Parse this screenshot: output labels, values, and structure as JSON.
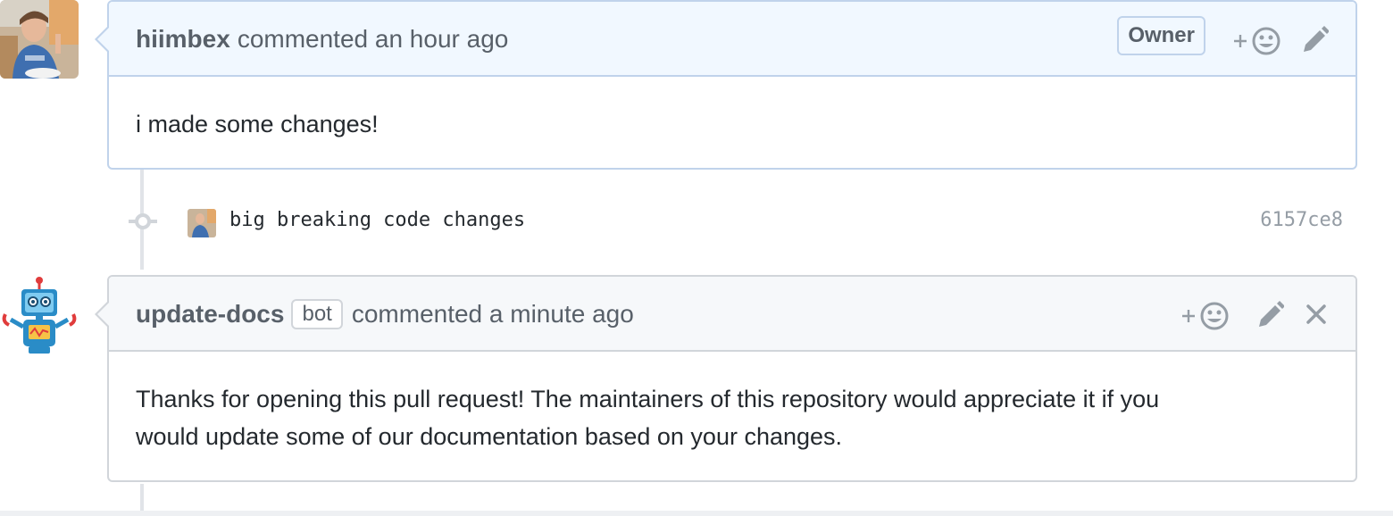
{
  "comment1": {
    "author": "hiimbex",
    "action": "commented an hour ago",
    "label": "Owner",
    "body": "i made some changes!",
    "icons": [
      "add-reaction-icon",
      "edit-pencil-icon"
    ]
  },
  "commit": {
    "message": "big breaking code changes",
    "sha": "6157ce8"
  },
  "comment2": {
    "author": "update-docs",
    "badge": "bot",
    "action": "commented a minute ago",
    "body_line1": "Thanks for opening this pull request! The maintainers of this repository would appreciate it if you",
    "body_line2": "would update some of our documentation based on your changes.",
    "icons": [
      "add-reaction-icon",
      "edit-pencil-icon",
      "close-icon"
    ]
  },
  "colors": {
    "owner_header_bg": "#f1f8ff",
    "owner_border": "#c0d3eb",
    "header_bg": "#f6f8fa",
    "border": "#d1d5da",
    "muted_text": "#586069"
  }
}
